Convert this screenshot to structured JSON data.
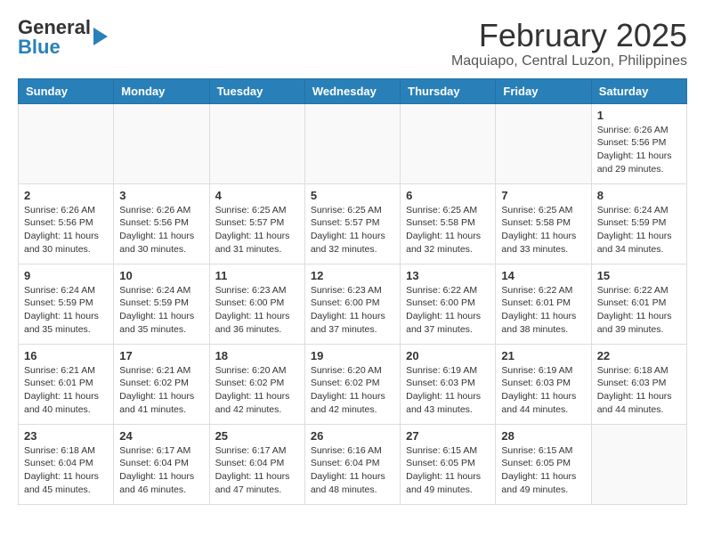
{
  "header": {
    "logo_general": "General",
    "logo_blue": "Blue",
    "month_title": "February 2025",
    "location": "Maquiapo, Central Luzon, Philippines"
  },
  "weekdays": [
    "Sunday",
    "Monday",
    "Tuesday",
    "Wednesday",
    "Thursday",
    "Friday",
    "Saturday"
  ],
  "weeks": [
    [
      {
        "day": "",
        "info": ""
      },
      {
        "day": "",
        "info": ""
      },
      {
        "day": "",
        "info": ""
      },
      {
        "day": "",
        "info": ""
      },
      {
        "day": "",
        "info": ""
      },
      {
        "day": "",
        "info": ""
      },
      {
        "day": "1",
        "info": "Sunrise: 6:26 AM\nSunset: 5:56 PM\nDaylight: 11 hours and 29 minutes."
      }
    ],
    [
      {
        "day": "2",
        "info": "Sunrise: 6:26 AM\nSunset: 5:56 PM\nDaylight: 11 hours and 30 minutes."
      },
      {
        "day": "3",
        "info": "Sunrise: 6:26 AM\nSunset: 5:56 PM\nDaylight: 11 hours and 30 minutes."
      },
      {
        "day": "4",
        "info": "Sunrise: 6:25 AM\nSunset: 5:57 PM\nDaylight: 11 hours and 31 minutes."
      },
      {
        "day": "5",
        "info": "Sunrise: 6:25 AM\nSunset: 5:57 PM\nDaylight: 11 hours and 32 minutes."
      },
      {
        "day": "6",
        "info": "Sunrise: 6:25 AM\nSunset: 5:58 PM\nDaylight: 11 hours and 32 minutes."
      },
      {
        "day": "7",
        "info": "Sunrise: 6:25 AM\nSunset: 5:58 PM\nDaylight: 11 hours and 33 minutes."
      },
      {
        "day": "8",
        "info": "Sunrise: 6:24 AM\nSunset: 5:59 PM\nDaylight: 11 hours and 34 minutes."
      }
    ],
    [
      {
        "day": "9",
        "info": "Sunrise: 6:24 AM\nSunset: 5:59 PM\nDaylight: 11 hours and 35 minutes."
      },
      {
        "day": "10",
        "info": "Sunrise: 6:24 AM\nSunset: 5:59 PM\nDaylight: 11 hours and 35 minutes."
      },
      {
        "day": "11",
        "info": "Sunrise: 6:23 AM\nSunset: 6:00 PM\nDaylight: 11 hours and 36 minutes."
      },
      {
        "day": "12",
        "info": "Sunrise: 6:23 AM\nSunset: 6:00 PM\nDaylight: 11 hours and 37 minutes."
      },
      {
        "day": "13",
        "info": "Sunrise: 6:22 AM\nSunset: 6:00 PM\nDaylight: 11 hours and 37 minutes."
      },
      {
        "day": "14",
        "info": "Sunrise: 6:22 AM\nSunset: 6:01 PM\nDaylight: 11 hours and 38 minutes."
      },
      {
        "day": "15",
        "info": "Sunrise: 6:22 AM\nSunset: 6:01 PM\nDaylight: 11 hours and 39 minutes."
      }
    ],
    [
      {
        "day": "16",
        "info": "Sunrise: 6:21 AM\nSunset: 6:01 PM\nDaylight: 11 hours and 40 minutes."
      },
      {
        "day": "17",
        "info": "Sunrise: 6:21 AM\nSunset: 6:02 PM\nDaylight: 11 hours and 41 minutes."
      },
      {
        "day": "18",
        "info": "Sunrise: 6:20 AM\nSunset: 6:02 PM\nDaylight: 11 hours and 42 minutes."
      },
      {
        "day": "19",
        "info": "Sunrise: 6:20 AM\nSunset: 6:02 PM\nDaylight: 11 hours and 42 minutes."
      },
      {
        "day": "20",
        "info": "Sunrise: 6:19 AM\nSunset: 6:03 PM\nDaylight: 11 hours and 43 minutes."
      },
      {
        "day": "21",
        "info": "Sunrise: 6:19 AM\nSunset: 6:03 PM\nDaylight: 11 hours and 44 minutes."
      },
      {
        "day": "22",
        "info": "Sunrise: 6:18 AM\nSunset: 6:03 PM\nDaylight: 11 hours and 44 minutes."
      }
    ],
    [
      {
        "day": "23",
        "info": "Sunrise: 6:18 AM\nSunset: 6:04 PM\nDaylight: 11 hours and 45 minutes."
      },
      {
        "day": "24",
        "info": "Sunrise: 6:17 AM\nSunset: 6:04 PM\nDaylight: 11 hours and 46 minutes."
      },
      {
        "day": "25",
        "info": "Sunrise: 6:17 AM\nSunset: 6:04 PM\nDaylight: 11 hours and 47 minutes."
      },
      {
        "day": "26",
        "info": "Sunrise: 6:16 AM\nSunset: 6:04 PM\nDaylight: 11 hours and 48 minutes."
      },
      {
        "day": "27",
        "info": "Sunrise: 6:15 AM\nSunset: 6:05 PM\nDaylight: 11 hours and 49 minutes."
      },
      {
        "day": "28",
        "info": "Sunrise: 6:15 AM\nSunset: 6:05 PM\nDaylight: 11 hours and 49 minutes."
      },
      {
        "day": "",
        "info": ""
      }
    ]
  ]
}
